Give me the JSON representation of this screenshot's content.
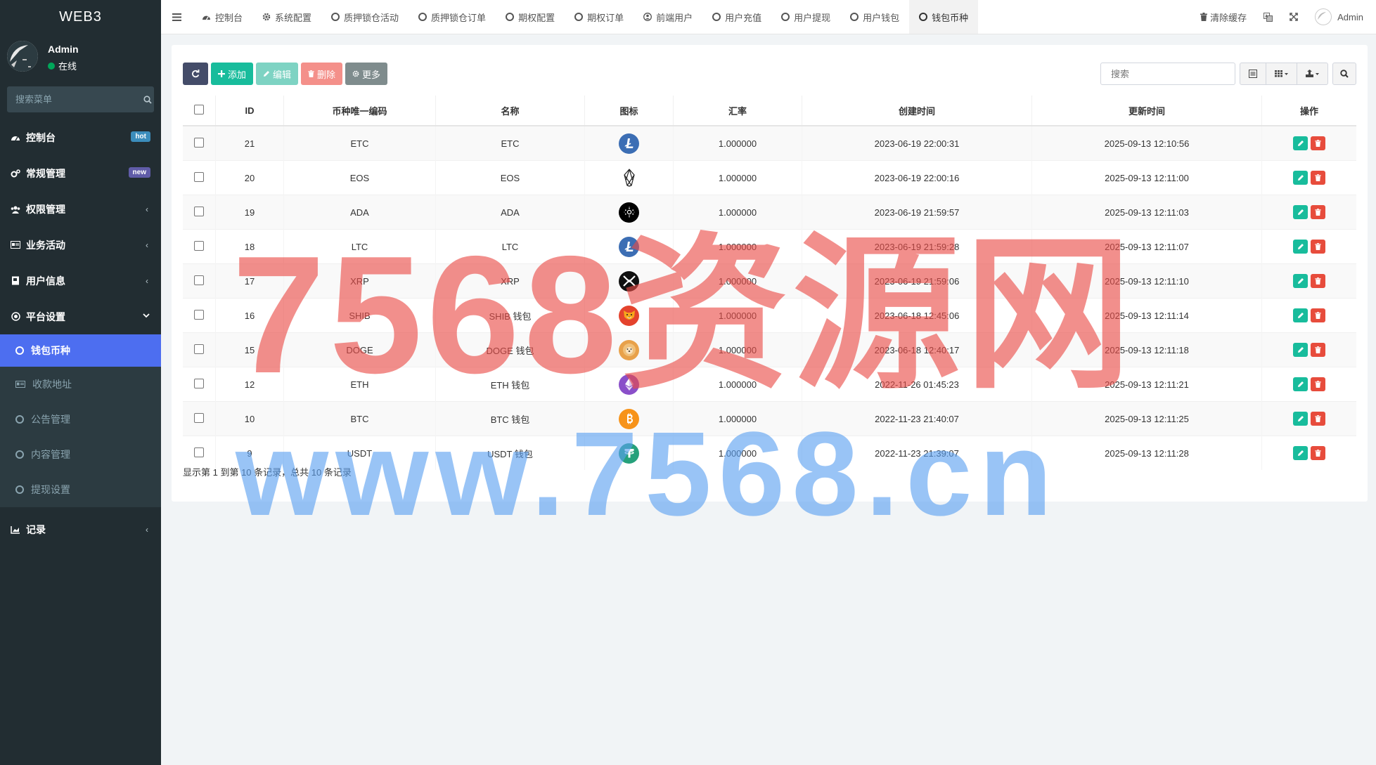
{
  "app": {
    "logo": "WEB3"
  },
  "user": {
    "name": "Admin",
    "status": "在线"
  },
  "sidebar": {
    "search_placeholder": "搜索菜单",
    "items": [
      {
        "label": "控制台",
        "icon": "dashboard-icon",
        "badge": "hot",
        "badge_color": "#3c8dbc"
      },
      {
        "label": "常规管理",
        "icon": "cogs-icon",
        "badge": "new",
        "badge_color": "#605ca8"
      },
      {
        "label": "权限管理",
        "icon": "group-icon"
      },
      {
        "label": "业务活动",
        "icon": "card-icon"
      },
      {
        "label": "用户信息",
        "icon": "book-icon"
      },
      {
        "label": "平台设置",
        "icon": "dot-circle-icon"
      }
    ],
    "subitems": [
      {
        "label": "钱包币种",
        "active": true
      },
      {
        "label": "收款地址"
      },
      {
        "label": "公告管理"
      },
      {
        "label": "内容管理"
      },
      {
        "label": "提现设置"
      }
    ],
    "last_item": {
      "label": "记录",
      "icon": "chart-icon"
    }
  },
  "navbar": {
    "tabs": [
      {
        "label": "控制台",
        "icon": "dashboard-icon"
      },
      {
        "label": "系统配置",
        "icon": "gear-icon"
      },
      {
        "label": "质押锁仓活动"
      },
      {
        "label": "质押锁仓订单"
      },
      {
        "label": "期权配置"
      },
      {
        "label": "期权订单"
      },
      {
        "label": "前端用户",
        "icon": "user-circle-icon"
      },
      {
        "label": "用户充值"
      },
      {
        "label": "用户提现"
      },
      {
        "label": "用户钱包"
      },
      {
        "label": "钱包币种",
        "active": true
      }
    ],
    "clear_cache": "清除缓存",
    "admin": "Admin"
  },
  "toolbar": {
    "add": "添加",
    "edit": "编辑",
    "delete": "删除",
    "more": "更多",
    "search_placeholder": "搜索"
  },
  "table": {
    "columns": [
      "ID",
      "币种唯一编码",
      "名称",
      "图标",
      "汇率",
      "创建时间",
      "更新时间",
      "操作"
    ],
    "rows": [
      {
        "id": "21",
        "code": "ETC",
        "name": "ETC",
        "icon": "litecoin-icon",
        "color": "#3c6eb4",
        "rate": "1.000000",
        "created": "2023-06-19 22:00:31",
        "updated": "2025-09-13 12:10:56"
      },
      {
        "id": "20",
        "code": "EOS",
        "name": "EOS",
        "icon": "eos-icon",
        "color": "#ffffff",
        "rate": "1.000000",
        "created": "2023-06-19 22:00:16",
        "updated": "2025-09-13 12:11:00"
      },
      {
        "id": "19",
        "code": "ADA",
        "name": "ADA",
        "icon": "cardano-icon",
        "color": "#000000",
        "rate": "1.000000",
        "created": "2023-06-19 21:59:57",
        "updated": "2025-09-13 12:11:03"
      },
      {
        "id": "18",
        "code": "LTC",
        "name": "LTC",
        "icon": "litecoin-icon",
        "color": "#3c6eb4",
        "rate": "1.000000",
        "created": "2023-06-19 21:59:28",
        "updated": "2025-09-13 12:11:07"
      },
      {
        "id": "17",
        "code": "XRP",
        "name": "XRP",
        "icon": "xrp-icon",
        "color": "#111111",
        "rate": "1.000000",
        "created": "2023-06-19 21:59:06",
        "updated": "2025-09-13 12:11:10"
      },
      {
        "id": "16",
        "code": "SHIB",
        "name": "SHIB 钱包",
        "icon": "shib-icon",
        "color": "#e4432d",
        "rate": "1.000000",
        "created": "2023-06-18 12:45:06",
        "updated": "2025-09-13 12:11:14"
      },
      {
        "id": "15",
        "code": "DOGE",
        "name": "DOGE 钱包",
        "icon": "doge-icon",
        "color": "#e8a14a",
        "rate": "1.000000",
        "created": "2023-06-18 12:40:17",
        "updated": "2025-09-13 12:11:18"
      },
      {
        "id": "12",
        "code": "ETH",
        "name": "ETH 钱包",
        "icon": "ethereum-icon",
        "color": "#8a4fc9",
        "rate": "1.000000",
        "created": "2022-11-26 01:45:23",
        "updated": "2025-09-13 12:11:21"
      },
      {
        "id": "10",
        "code": "BTC",
        "name": "BTC 钱包",
        "icon": "bitcoin-icon",
        "color": "#f7931a",
        "rate": "1.000000",
        "created": "2022-11-23 21:40:07",
        "updated": "2025-09-13 12:11:25"
      },
      {
        "id": "9",
        "code": "USDT",
        "name": "USDT 钱包",
        "icon": "tether-icon",
        "color": "#26a17b",
        "rate": "1.000000",
        "created": "2022-11-23 21:39:07",
        "updated": "2025-09-13 12:11:28"
      }
    ]
  },
  "pagination": {
    "info": "显示第 1 到第 10 条记录，总共 10 条记录"
  },
  "watermark": {
    "line1": "7568资源网",
    "line2": "www.7568.cn"
  },
  "colors": {
    "sidebar_bg": "#222d32",
    "active_blue": "#4d6ef0",
    "refresh": "#444c69",
    "add": "#18bc9c",
    "edit": "#7ed3c3",
    "delete": "#f4908a",
    "more": "#7f8c8d",
    "op_edit": "#18bc9c",
    "op_delete": "#e74c3c"
  }
}
